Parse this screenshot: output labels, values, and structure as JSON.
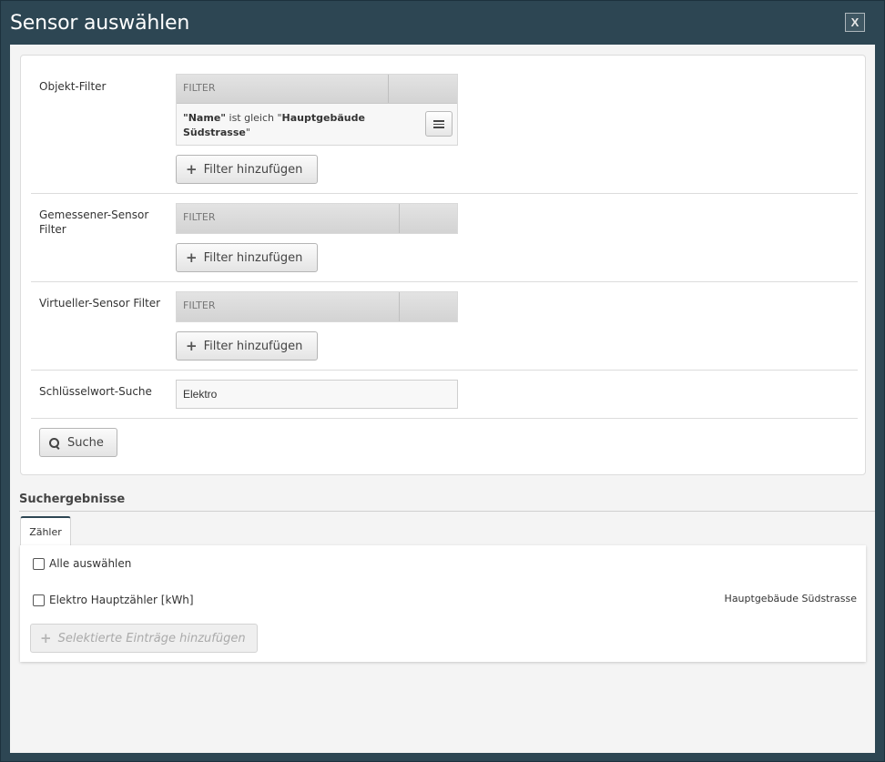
{
  "dialog": {
    "title": "Sensor auswählen",
    "close_label": "X"
  },
  "filters": {
    "object_filter": {
      "label": "Objekt-Filter",
      "column_header": "FILTER",
      "rule": {
        "field": "\"Name\"",
        "operator": " ist gleich \"",
        "value": "Hauptgebäude Südstrasse",
        "suffix": "\""
      },
      "add_label": "Filter hinzufügen"
    },
    "measured_filter": {
      "label": "Gemessener-Sensor Filter",
      "column_header": "FILTER",
      "add_label": "Filter hinzufügen"
    },
    "virtual_filter": {
      "label": "Virtueller-Sensor Filter",
      "column_header": "FILTER",
      "add_label": "Filter hinzufügen"
    },
    "keyword": {
      "label": "Schlüsselwort-Suche",
      "value": "Elektro"
    },
    "search_label": "Suche"
  },
  "results": {
    "title": "Suchergebnisse",
    "tab_label": "Zähler",
    "select_all_label": "Alle auswählen",
    "items": [
      {
        "name": "Elektro Hauptzähler [kWh]",
        "location": "Hauptgebäude Südstrasse"
      }
    ],
    "add_selected_label": "Selektierte Einträge hinzufügen"
  },
  "icons": {
    "plus": "plus-icon",
    "search": "search-icon",
    "menu": "menu-icon"
  }
}
